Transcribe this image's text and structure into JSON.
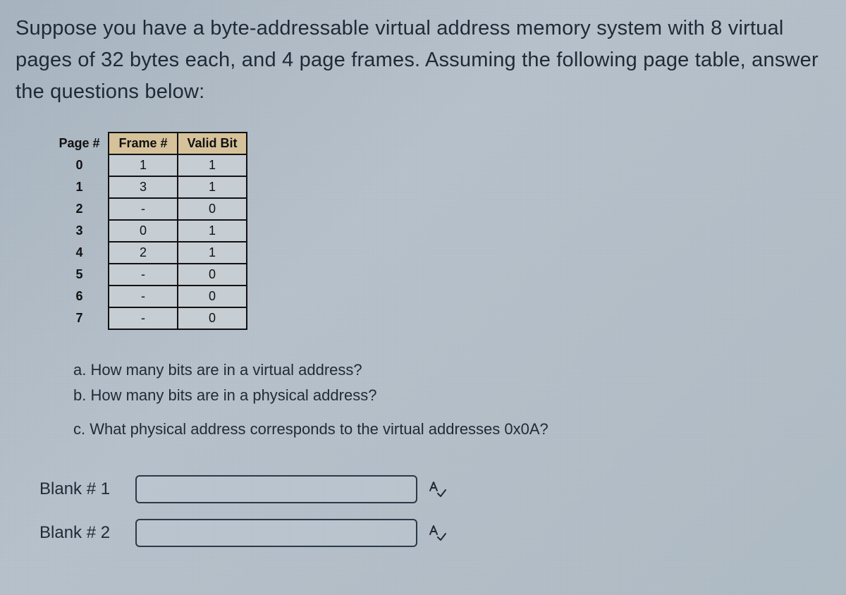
{
  "prompt": "Suppose you have a byte-addressable virtual address memory system with 8 virtual pages of 32 bytes each, and 4 page frames. Assuming the following page table, answer the questions below:",
  "table": {
    "headers": {
      "page": "Page #",
      "frame": "Frame #",
      "valid": "Valid Bit"
    },
    "rows": [
      {
        "page": "0",
        "frame": "1",
        "valid": "1"
      },
      {
        "page": "1",
        "frame": "3",
        "valid": "1"
      },
      {
        "page": "2",
        "frame": "-",
        "valid": "0"
      },
      {
        "page": "3",
        "frame": "0",
        "valid": "1"
      },
      {
        "page": "4",
        "frame": "2",
        "valid": "1"
      },
      {
        "page": "5",
        "frame": "-",
        "valid": "0"
      },
      {
        "page": "6",
        "frame": "-",
        "valid": "0"
      },
      {
        "page": "7",
        "frame": "-",
        "valid": "0"
      }
    ]
  },
  "questions": {
    "a": "a. How many bits are in a virtual address?",
    "b": "b. How many bits are in a physical address?",
    "c": "c. What physical address corresponds to the virtual addresses 0x0A?"
  },
  "blanks": {
    "b1_label": "Blank # 1",
    "b2_label": "Blank # 2",
    "b1_value": "",
    "b2_value": ""
  }
}
